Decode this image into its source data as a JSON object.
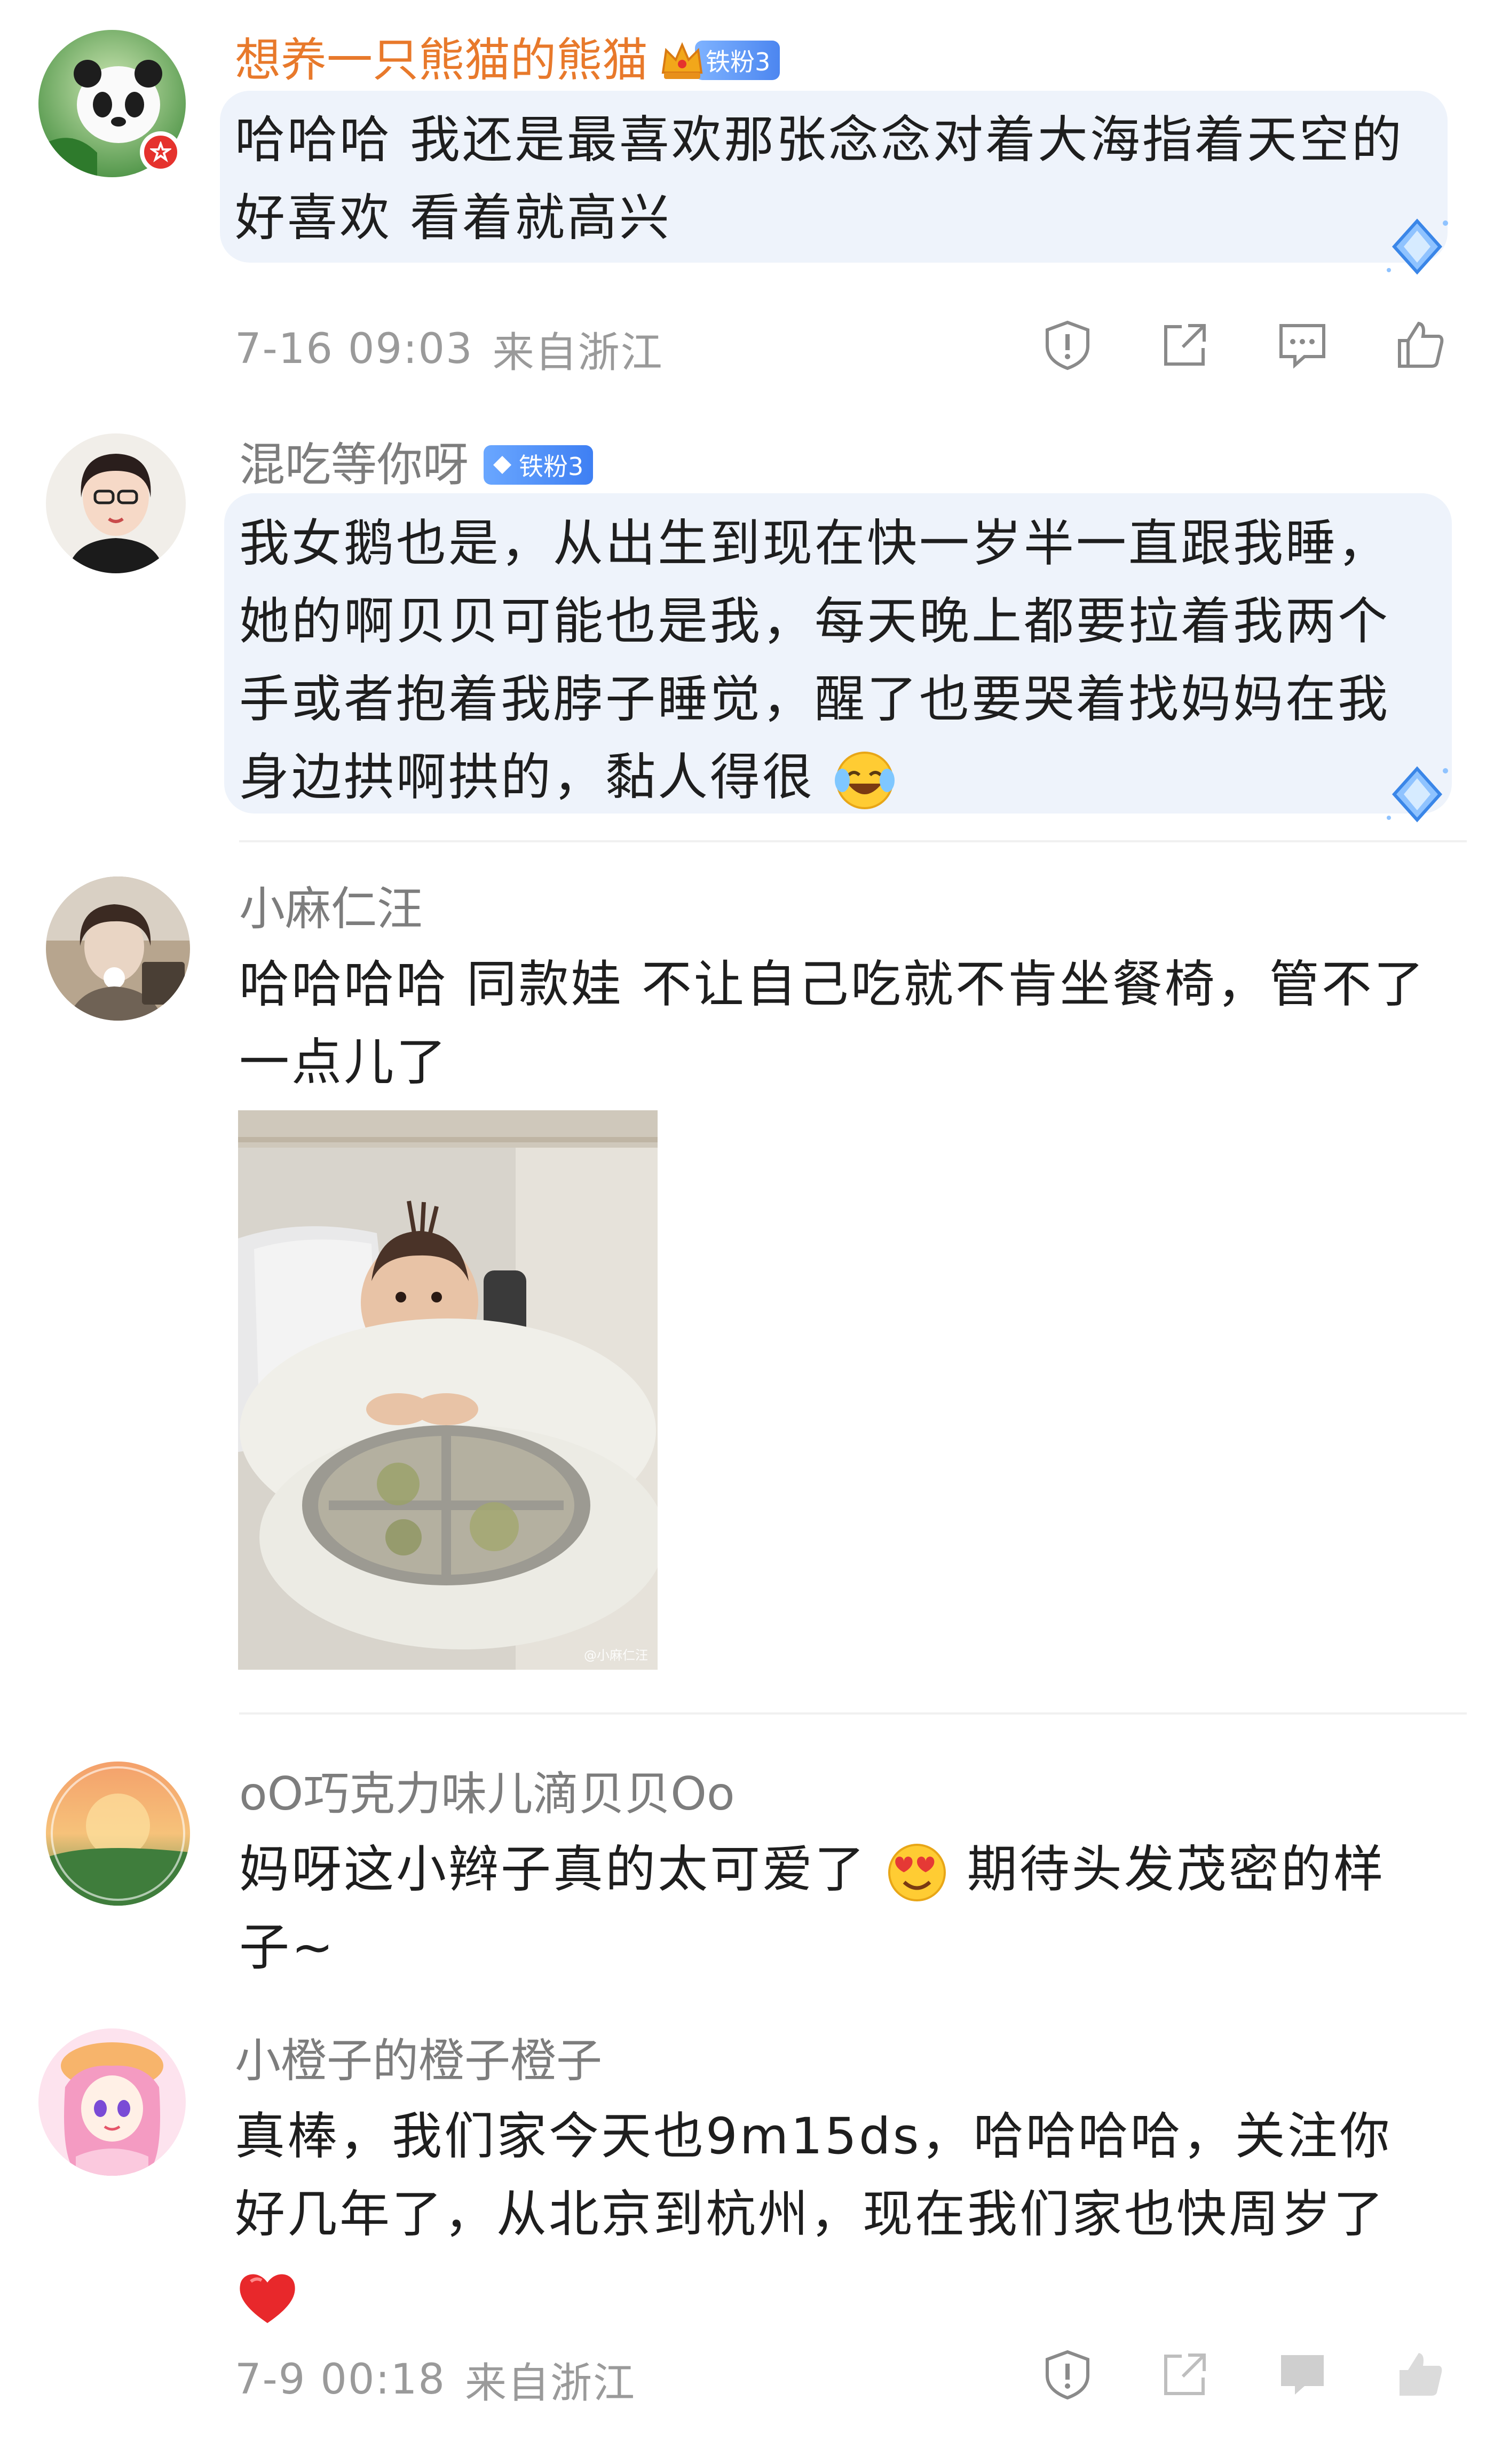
{
  "comments": [
    {
      "username": "想养一只熊猫的熊猫",
      "fan_badge": "铁粉3",
      "text": "哈哈哈 我还是最喜欢那张念念对着大海指着天空的好喜欢 看着就高兴",
      "timestamp": "7-16 09:03",
      "location": "来自浙江",
      "actions": [
        "report-icon",
        "share-icon",
        "comment-icon",
        "like-icon"
      ]
    },
    {
      "username": "混吃等你呀",
      "fan_badge": "铁粉3",
      "text": "我女鹅也是，从出生到现在快一岁半一直跟我睡，她的啊贝贝可能也是我，每天晚上都要拉着我两个手或者抱着我脖子睡觉，醒了也要哭着找妈妈在我身边拱啊拱的，黏人得很"
    },
    {
      "username": "小麻仁汪",
      "text": "哈哈哈哈 同款娃 不让自己吃就不肯坐餐椅，管不了一点儿了",
      "photo_watermark": "@小麻仁汪"
    },
    {
      "username": "oO巧克力味儿滴贝贝Oo",
      "text_before_emoji": "妈呀这小辫子真的太可爱了",
      "text_after_emoji": "期待头发茂密的样子~"
    },
    {
      "username": "小橙子的橙子橙子",
      "text": "真棒，我们家今天也9m15ds，哈哈哈哈，关注你好几年了，从北京到杭州，现在我们家也快周岁了",
      "timestamp": "7-9 00:18",
      "location": "来自浙江"
    }
  ],
  "colors": {
    "vip_name": "#e8792b",
    "normal_name": "#7d7d7d",
    "bubble_bg": "#eef3fb",
    "badge_blue": "#4c86f0",
    "meta_gray": "#9a9a9a"
  }
}
